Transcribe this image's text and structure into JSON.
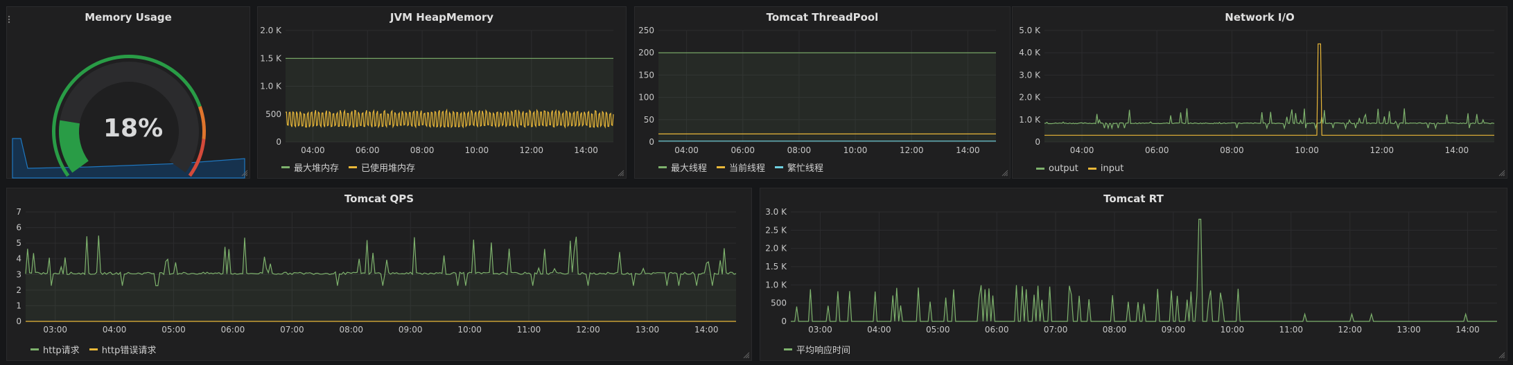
{
  "colors": {
    "green": "#7eb26d",
    "yellow": "#eab839",
    "blue": "#6ed0e0",
    "grid": "#2c2c2e",
    "axis_text": "#c8c8c8",
    "gauge_green": "#299c46",
    "gauge_red": "#d44a3a",
    "spark": "#1f78c1"
  },
  "memory": {
    "title": "Memory Usage",
    "value_text": "18%",
    "value_fraction": 0.18
  },
  "chart_data": [
    {
      "id": "jvm",
      "type": "line",
      "title": "JVM HeapMemory",
      "xticks": [
        "04:00",
        "06:00",
        "08:00",
        "10:00",
        "12:00",
        "14:00"
      ],
      "yticks": [
        "0",
        "500",
        "1.0 K",
        "1.5 K",
        "2.0 K"
      ],
      "ylim": [
        0,
        2000
      ],
      "series": [
        {
          "name": "最大堆内存",
          "color": "#7eb26d",
          "pattern": "flat",
          "base": 1500
        },
        {
          "name": "已使用堆内存",
          "color": "#eab839",
          "pattern": "saw",
          "base": 380,
          "amp": 160
        }
      ]
    },
    {
      "id": "thread",
      "type": "line",
      "title": "Tomcat ThreadPool",
      "xticks": [
        "04:00",
        "06:00",
        "08:00",
        "10:00",
        "12:00",
        "14:00"
      ],
      "yticks": [
        "0",
        "50",
        "100",
        "150",
        "200",
        "250"
      ],
      "ylim": [
        0,
        250
      ],
      "series": [
        {
          "name": "最大线程",
          "color": "#7eb26d",
          "pattern": "flat",
          "base": 200
        },
        {
          "name": "当前线程",
          "color": "#eab839",
          "pattern": "flat",
          "base": 18
        },
        {
          "name": "繁忙线程",
          "color": "#6ed0e0",
          "pattern": "flat",
          "base": 2
        }
      ]
    },
    {
      "id": "net",
      "type": "line",
      "title": "Network I/O",
      "xticks": [
        "04:00",
        "06:00",
        "08:00",
        "10:00",
        "12:00",
        "14:00"
      ],
      "yticks": [
        "0",
        "1.0 K",
        "2.0 K",
        "3.0 K",
        "4.0 K",
        "5.0 K"
      ],
      "ylim": [
        0,
        5000
      ],
      "series": [
        {
          "name": "output",
          "color": "#7eb26d",
          "pattern": "spiky",
          "base": 820,
          "amp": 500
        },
        {
          "name": "input",
          "color": "#eab839",
          "pattern": "flat-spike",
          "base": 300,
          "spike_at": 0.61,
          "spike": 4400
        }
      ]
    },
    {
      "id": "qps",
      "type": "line",
      "title": "Tomcat QPS",
      "xticks": [
        "03:00",
        "04:00",
        "05:00",
        "06:00",
        "07:00",
        "08:00",
        "09:00",
        "10:00",
        "11:00",
        "12:00",
        "13:00",
        "14:00"
      ],
      "yticks": [
        "0",
        "1",
        "2",
        "3",
        "4",
        "5",
        "6",
        "7"
      ],
      "ylim": [
        0,
        7
      ],
      "series": [
        {
          "name": "http请求",
          "color": "#7eb26d",
          "pattern": "spiky",
          "base": 3,
          "amp": 1.8
        },
        {
          "name": "http错误请求",
          "color": "#eab839",
          "pattern": "flat",
          "base": 0
        }
      ]
    },
    {
      "id": "rt",
      "type": "line",
      "title": "Tomcat RT",
      "xticks": [
        "03:00",
        "04:00",
        "05:00",
        "06:00",
        "07:00",
        "08:00",
        "09:00",
        "10:00",
        "11:00",
        "12:00",
        "13:00",
        "14:00"
      ],
      "yticks": [
        "0",
        "500",
        "1.0 K",
        "1.5 K",
        "2.0 K",
        "2.5 K",
        "3.0 K"
      ],
      "ylim": [
        0,
        3000
      ],
      "series": [
        {
          "name": "平均响应时间",
          "color": "#7eb26d",
          "pattern": "bursts",
          "base": 0,
          "amp": 1000,
          "spike_at": 0.58,
          "spike": 2800
        }
      ]
    }
  ]
}
